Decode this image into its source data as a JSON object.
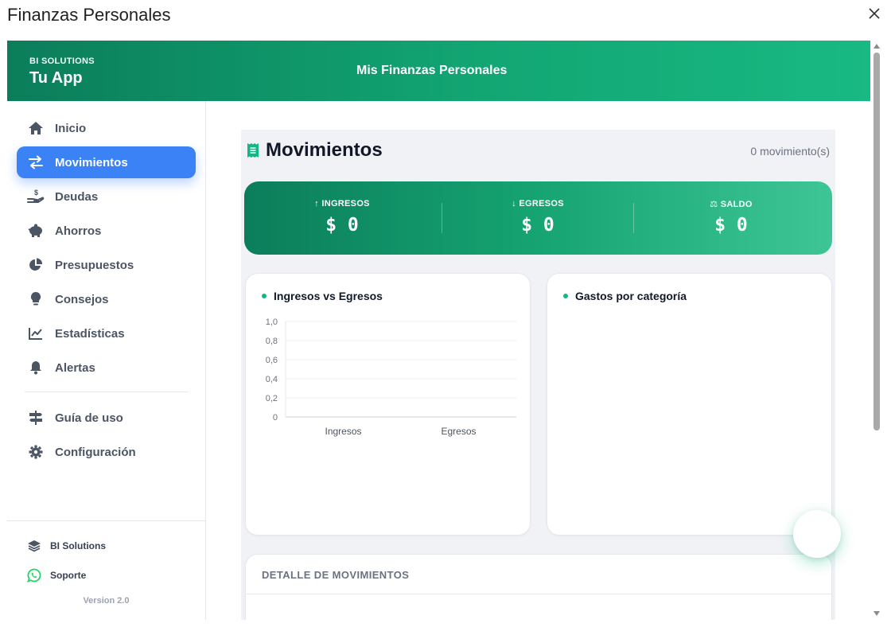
{
  "window": {
    "title": "Finanzas Personales"
  },
  "header": {
    "brand_small": "BI SOLUTIONS",
    "brand_name": "Tu App",
    "title": "Mis Finanzas Personales"
  },
  "sidebar": {
    "items": [
      {
        "label": "Inicio",
        "icon": "home-icon"
      },
      {
        "label": "Movimientos",
        "icon": "swap-arrows-icon",
        "active": true
      },
      {
        "label": "Deudas",
        "icon": "hand-coin-icon"
      },
      {
        "label": "Ahorros",
        "icon": "piggy-bank-icon"
      },
      {
        "label": "Presupuestos",
        "icon": "pie-chart-icon"
      },
      {
        "label": "Consejos",
        "icon": "lightbulb-icon"
      },
      {
        "label": "Estadísticas",
        "icon": "line-chart-icon"
      },
      {
        "label": "Alertas",
        "icon": "bell-icon"
      },
      {
        "label": "Guía de uso",
        "icon": "signpost-icon"
      },
      {
        "label": "Configuración",
        "icon": "gear-icon"
      }
    ],
    "footer": {
      "company": "BI Solutions",
      "support": "Soporte",
      "version": "Version 2.0"
    }
  },
  "main": {
    "title": "Movimientos",
    "count": "0 movimiento(s)",
    "summary": {
      "income": {
        "label": "INGRESOS",
        "value": "$ 0"
      },
      "expense": {
        "label": "EGRESOS",
        "value": "$ 0"
      },
      "balance": {
        "label": "SALDO",
        "value": "$ 0"
      }
    },
    "chart_income_vs_expense": {
      "title": "Ingresos vs Egresos"
    },
    "chart_by_category": {
      "title": "Gastos por categoría"
    },
    "detail": {
      "title": "DETALLE DE MOVIMIENTOS"
    }
  },
  "colors": {
    "accent_green": "#10b981",
    "header_dark": "#0b7d5a",
    "active_blue": "#3b82f6"
  },
  "chart_data": {
    "type": "bar",
    "categories": [
      "Ingresos",
      "Egresos"
    ],
    "values": [
      0,
      0
    ],
    "title": "Ingresos vs Egresos",
    "xlabel": "",
    "ylabel": "",
    "ylim": [
      0,
      1
    ],
    "yticks": [
      "0",
      "0,2",
      "0,4",
      "0,6",
      "0,8",
      "1,0"
    ],
    "grid": true
  }
}
